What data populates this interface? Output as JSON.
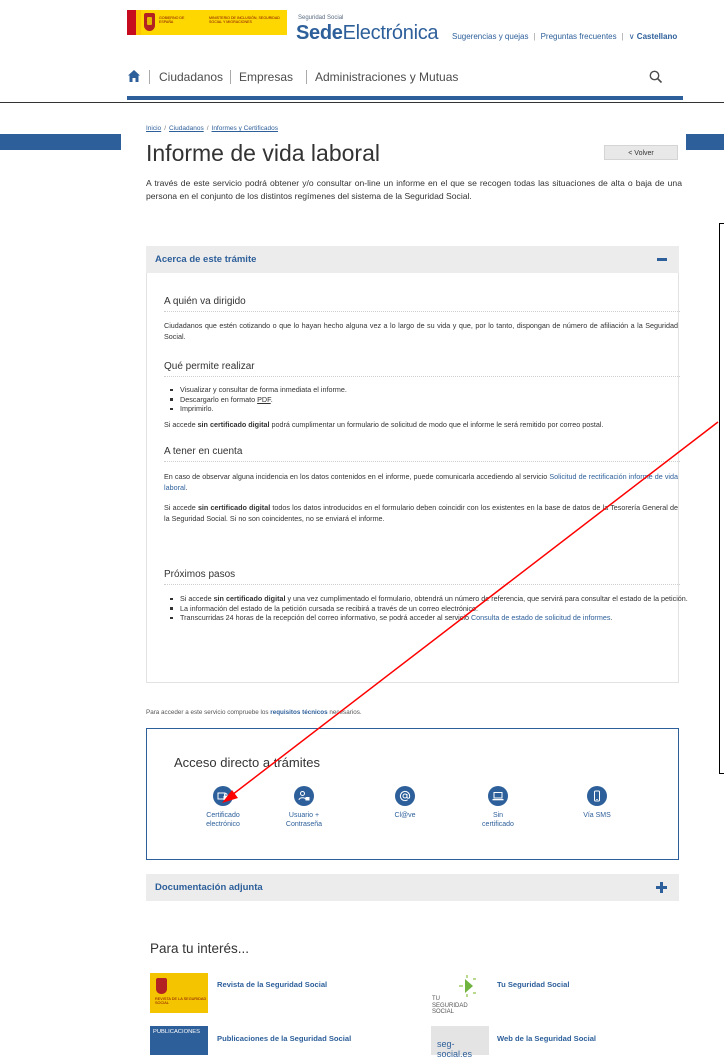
{
  "header": {
    "gov_logo_text_1": "GOBIERNO DE ESPAÑA",
    "gov_logo_text_2": "MINISTERIO DE INCLUSIÓN, SEGURIDAD SOCIAL Y MIGRACIONES",
    "sede_small": "Seguridad Social",
    "sede_bold": "Sede",
    "sede_light": "Electrónica",
    "links": [
      "Sugerencias y quejas",
      "Preguntas frecuentes"
    ],
    "language": "Castellano",
    "language_chevron": "∨"
  },
  "nav": {
    "items": [
      "Ciudadanos",
      "Empresas",
      "Administraciones y Mutuas"
    ]
  },
  "breadcrumb": [
    "Inicio",
    "Ciudadanos",
    "Informes y Certificados"
  ],
  "page": {
    "title": "Informe de vida laboral",
    "back_label": "< Volver",
    "intro": "A través de este servicio podrá obtener y/o consultar on-line un informe en el que se recogen todas las situaciones de alta o baja de una persona en el conjunto de los distintos regímenes del sistema de la Seguridad Social."
  },
  "about": {
    "title": "Acerca de este trámite",
    "s1_title": "A quién va dirigido",
    "s1_text": "Ciudadanos que estén cotizando o que lo hayan hecho alguna vez a lo largo de su vida  y que, por lo tanto, dispongan de número de afiliación a la Seguridad Social.",
    "s2_title": "Qué permite realizar",
    "s2_items": [
      "Visualizar y consultar de forma inmediata el informe.",
      "Descargarlo en formato ",
      "Imprimirlo."
    ],
    "s2_pdf": "PDF",
    "s2_note_pre": "Si accede ",
    "s2_note_bold": "sin certificado digital",
    "s2_note_post": " podrá cumplimentar un formulario de solicitud de modo que el informe le será remitido por correo postal.",
    "s3_title": "A tener en cuenta",
    "s3_p1_pre": "En caso de observar alguna incidencia en los datos contenidos en el informe, puede comunicarla accediendo al servicio ",
    "s3_p1_link": "Solicitud de rectificación informe de vida laboral",
    "s3_p2_pre": "Si accede ",
    "s3_p2_bold": "sin certificado digital",
    "s3_p2_post": " todos los datos introducidos en el formulario deben coincidir con los existentes en la base de datos de la Tesorería General de la Seguridad Social. Si no son coincidentes, no se enviará el informe.",
    "s4_title": "Próximos pasos",
    "s4_i1_pre": "Si accede ",
    "s4_i1_bold": "sin certificado digital",
    "s4_i1_post": " y una vez cumplimentado el formulario, obtendrá un número de referencia, que servirá para consultar el estado de la petición.",
    "s4_i2": "La información del estado de la petición cursada se recibirá a través de un correo electrónico.",
    "s4_i3_pre": "Transcurridas 24 horas de la recepción del correo informativo, se podrá acceder al servicio ",
    "s4_i3_link": "Consulta de estado de solicitud de informes"
  },
  "requirements": {
    "pre": "Para acceder a este servicio compruebe los ",
    "link": "requisitos técnicos",
    "post": " necesarios."
  },
  "access": {
    "title": "Acceso directo a trámites",
    "options": [
      {
        "l1": "Certificado",
        "l2": "electrónico",
        "icon": "certificate-lock-icon"
      },
      {
        "l1": "Usuario +",
        "l2": "Contraseña",
        "icon": "user-lock-icon"
      },
      {
        "l1": "Cl@ve",
        "l2": "",
        "icon": "at-sign-icon"
      },
      {
        "l1": "Sin",
        "l2": "certificado",
        "icon": "laptop-icon"
      },
      {
        "l1": "Vía SMS",
        "l2": "",
        "icon": "mobile-phone-icon"
      }
    ]
  },
  "documentation": {
    "title": "Documentación adjunta"
  },
  "interest": {
    "title": "Para tu interés...",
    "links": [
      "Revista de la Seguridad Social",
      "Tu Seguridad Social",
      "Publicaciones de la Seguridad Social",
      "Web de la Seguridad Social"
    ],
    "logo_revista": "REVISTA DE LA SEGURIDAD SOCIAL",
    "logo_tu_1": "TU",
    "logo_tu_2": "SEGURIDAD SOCIAL",
    "logo_pub": "PUBLICACIONES",
    "logo_web": "seg-social.es"
  },
  "colors": {
    "brand_blue": "#2d5f9a",
    "annotation_red": "#ff0000"
  }
}
